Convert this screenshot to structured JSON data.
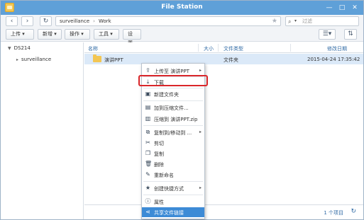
{
  "window": {
    "title": "File Station"
  },
  "nav": {
    "path": [
      "surveillance",
      "Work"
    ],
    "search_placeholder": "过滤"
  },
  "toolbar": {
    "upload": "上传 ▾",
    "new": "新增 ▾",
    "action": "操作 ▾",
    "tools": "工具 ▾",
    "settings": "设置"
  },
  "sidebar": {
    "root": "DS214",
    "children": [
      "surveillance"
    ]
  },
  "table": {
    "columns": [
      "名称",
      "大小",
      "文件类型",
      "修改日期"
    ],
    "rows": [
      {
        "name": "演讲PPT",
        "size": "",
        "type": "文件夹",
        "modified": "2015-04-24 17:35:42"
      }
    ],
    "footer_count": "1 个项目"
  },
  "context_menu": {
    "items": [
      {
        "icon": "upload-icon",
        "label": "上传至 演讲PPT",
        "arrow": true
      },
      {
        "icon": "download-icon",
        "label": "下载",
        "arrow": false,
        "highlighted": true
      },
      {
        "icon": "new-folder-icon",
        "label": "新建文件夹",
        "arrow": false
      },
      {
        "icon": "archive-icon",
        "label": "加到压缩文件...",
        "arrow": false
      },
      {
        "icon": "zip-icon",
        "label": "压缩到 演讲PPT.zip",
        "arrow": false
      },
      {
        "icon": "copy-move-icon",
        "label": "复制到/移动到 ...",
        "arrow": true
      },
      {
        "icon": "cut-icon",
        "label": "剪切",
        "arrow": false
      },
      {
        "icon": "copy-icon",
        "label": "复制",
        "arrow": false
      },
      {
        "icon": "delete-icon",
        "label": "删除",
        "arrow": false
      },
      {
        "icon": "rename-icon",
        "label": "重新命名",
        "arrow": false
      },
      {
        "icon": "shortcut-icon",
        "label": "创建快捷方式",
        "arrow": true
      },
      {
        "icon": "info-icon",
        "label": "属性",
        "arrow": false
      },
      {
        "icon": "share-icon",
        "label": "共享文件链接",
        "arrow": false,
        "active": true
      }
    ]
  },
  "colors": {
    "titlebar": "#5fa0d8",
    "selected_row": "#dbe9f8",
    "menu_active": "#3d8bd6",
    "highlight_outline": "#d9262a"
  }
}
